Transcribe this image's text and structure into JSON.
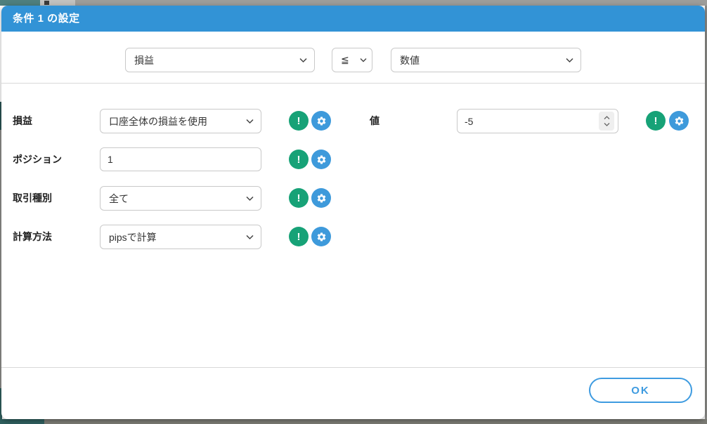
{
  "window": {
    "title": "条件 1 の設定"
  },
  "condition_bar": {
    "target_select": {
      "value": "損益"
    },
    "operator_select": {
      "value": "≦"
    },
    "compare_select": {
      "value": "数値"
    }
  },
  "form": {
    "profit_loss": {
      "label": "損益",
      "value": "口座全体の損益を使用"
    },
    "position": {
      "label": "ポジション",
      "value": "1"
    },
    "trade_type": {
      "label": "取引種別",
      "value": "全て"
    },
    "calc_method": {
      "label": "計算方法",
      "value": "pipsで計算"
    },
    "value": {
      "label": "値",
      "value": "-5"
    }
  },
  "icons": {
    "exclamation": "!",
    "gear": "gear-icon",
    "chevron_down": "chevron-down-icon"
  },
  "footer": {
    "ok_label": "OK"
  },
  "colors": {
    "header_blue": "#3293d6",
    "button_blue": "#3e9adb",
    "button_green": "#17a277",
    "ok_border_blue": "#3e9be0",
    "background_teal": "#2f5f5e",
    "background_gray": "#8f8f8b"
  }
}
